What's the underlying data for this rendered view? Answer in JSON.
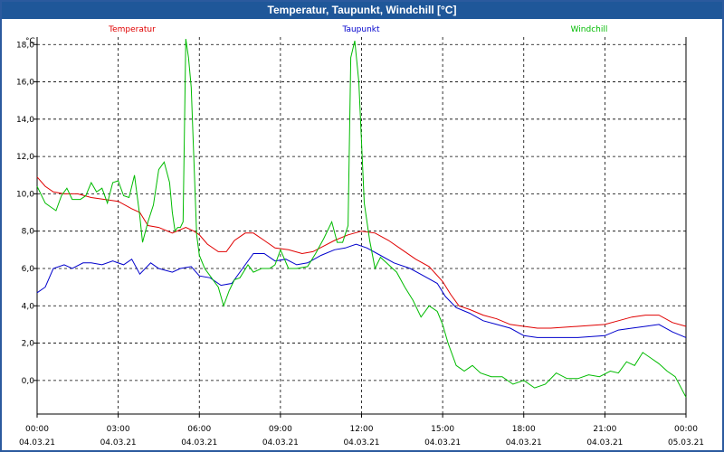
{
  "window": {
    "title": "Temperatur, Taupunkt, Windchill [°C]"
  },
  "chart_data": {
    "type": "line",
    "title": "Temperatur, Taupunkt, Windchill [°C]",
    "ylabel": "°C",
    "xlabel": "",
    "ylim": [
      -1.8,
      18.4
    ],
    "xlim": [
      0,
      24
    ],
    "grid": true,
    "legend_position": "top",
    "y_ticks": [
      "0,0",
      "2,0",
      "4,0",
      "6,0",
      "8,0",
      "10,0",
      "12,0",
      "14,0",
      "16,0",
      "18,0"
    ],
    "y_tick_values": [
      0,
      2,
      4,
      6,
      8,
      10,
      12,
      14,
      16,
      18
    ],
    "x_ticks": [
      {
        "time": "00:00",
        "date": "04.03.21",
        "x": 0
      },
      {
        "time": "03:00",
        "date": "04.03.21",
        "x": 3
      },
      {
        "time": "06:00",
        "date": "04.03.21",
        "x": 6
      },
      {
        "time": "09:00",
        "date": "04.03.21",
        "x": 9
      },
      {
        "time": "12:00",
        "date": "04.03.21",
        "x": 12
      },
      {
        "time": "15:00",
        "date": "04.03.21",
        "x": 15
      },
      {
        "time": "18:00",
        "date": "04.03.21",
        "x": 18
      },
      {
        "time": "21:00",
        "date": "04.03.21",
        "x": 21
      },
      {
        "time": "00:00",
        "date": "05.03.21",
        "x": 24
      }
    ],
    "series": [
      {
        "name": "Temperatur",
        "color": "#e00000",
        "points": [
          [
            0,
            10.9
          ],
          [
            0.3,
            10.4
          ],
          [
            0.6,
            10.1
          ],
          [
            1,
            10.0
          ],
          [
            1.5,
            10.0
          ],
          [
            2,
            9.8
          ],
          [
            2.5,
            9.7
          ],
          [
            3,
            9.6
          ],
          [
            3.5,
            9.2
          ],
          [
            3.8,
            9.0
          ],
          [
            4.1,
            8.3
          ],
          [
            4.5,
            8.2
          ],
          [
            5,
            7.9
          ],
          [
            5.5,
            8.2
          ],
          [
            5.8,
            8.0
          ],
          [
            6,
            7.8
          ],
          [
            6.3,
            7.3
          ],
          [
            6.7,
            6.9
          ],
          [
            7,
            6.9
          ],
          [
            7.3,
            7.5
          ],
          [
            7.7,
            7.9
          ],
          [
            8,
            7.9
          ],
          [
            8.4,
            7.5
          ],
          [
            8.8,
            7.1
          ],
          [
            9.3,
            7.0
          ],
          [
            9.8,
            6.8
          ],
          [
            10.2,
            6.9
          ],
          [
            10.6,
            7.2
          ],
          [
            11,
            7.5
          ],
          [
            11.5,
            7.8
          ],
          [
            12,
            8.0
          ],
          [
            12.5,
            7.9
          ],
          [
            13,
            7.5
          ],
          [
            13.5,
            7.0
          ],
          [
            14,
            6.5
          ],
          [
            14.5,
            6.1
          ],
          [
            15,
            5.3
          ],
          [
            15.3,
            4.6
          ],
          [
            15.6,
            4.0
          ],
          [
            16,
            3.8
          ],
          [
            16.5,
            3.5
          ],
          [
            17,
            3.3
          ],
          [
            17.5,
            3.0
          ],
          [
            18,
            2.9
          ],
          [
            18.5,
            2.8
          ],
          [
            19,
            2.8
          ],
          [
            20,
            2.9
          ],
          [
            21,
            3.0
          ],
          [
            21.5,
            3.2
          ],
          [
            22,
            3.4
          ],
          [
            22.5,
            3.5
          ],
          [
            23,
            3.5
          ],
          [
            23.5,
            3.1
          ],
          [
            24,
            2.9
          ]
        ]
      },
      {
        "name": "Taupunkt",
        "color": "#0000cc",
        "points": [
          [
            0,
            4.7
          ],
          [
            0.3,
            5.0
          ],
          [
            0.6,
            6.0
          ],
          [
            1,
            6.2
          ],
          [
            1.3,
            6.0
          ],
          [
            1.7,
            6.3
          ],
          [
            2,
            6.3
          ],
          [
            2.4,
            6.2
          ],
          [
            2.8,
            6.4
          ],
          [
            3.2,
            6.2
          ],
          [
            3.5,
            6.5
          ],
          [
            3.8,
            5.7
          ],
          [
            4.2,
            6.3
          ],
          [
            4.5,
            6.0
          ],
          [
            5,
            5.8
          ],
          [
            5.3,
            6.0
          ],
          [
            5.7,
            6.1
          ],
          [
            6,
            5.6
          ],
          [
            6.4,
            5.5
          ],
          [
            6.8,
            5.1
          ],
          [
            7.2,
            5.2
          ],
          [
            7.6,
            6.0
          ],
          [
            8,
            6.8
          ],
          [
            8.4,
            6.8
          ],
          [
            8.8,
            6.4
          ],
          [
            9.2,
            6.5
          ],
          [
            9.6,
            6.2
          ],
          [
            10,
            6.3
          ],
          [
            10.5,
            6.7
          ],
          [
            11,
            7.0
          ],
          [
            11.4,
            7.1
          ],
          [
            11.8,
            7.3
          ],
          [
            12.2,
            7.1
          ],
          [
            12.7,
            6.7
          ],
          [
            13.2,
            6.3
          ],
          [
            13.8,
            6.0
          ],
          [
            14.3,
            5.6
          ],
          [
            14.8,
            5.2
          ],
          [
            15.1,
            4.5
          ],
          [
            15.5,
            3.9
          ],
          [
            16,
            3.6
          ],
          [
            16.5,
            3.2
          ],
          [
            17,
            3.0
          ],
          [
            17.5,
            2.8
          ],
          [
            18,
            2.4
          ],
          [
            18.5,
            2.3
          ],
          [
            19,
            2.3
          ],
          [
            20,
            2.3
          ],
          [
            21,
            2.4
          ],
          [
            21.5,
            2.7
          ],
          [
            22,
            2.8
          ],
          [
            22.5,
            2.9
          ],
          [
            23,
            3.0
          ],
          [
            23.5,
            2.6
          ],
          [
            24,
            2.3
          ]
        ]
      },
      {
        "name": "Windchill",
        "color": "#00bb00",
        "points": [
          [
            0,
            10.4
          ],
          [
            0.3,
            9.5
          ],
          [
            0.5,
            9.3
          ],
          [
            0.7,
            9.1
          ],
          [
            0.9,
            9.9
          ],
          [
            1.1,
            10.3
          ],
          [
            1.3,
            9.7
          ],
          [
            1.6,
            9.7
          ],
          [
            1.8,
            9.9
          ],
          [
            2,
            10.6
          ],
          [
            2.2,
            10.1
          ],
          [
            2.4,
            10.3
          ],
          [
            2.6,
            9.5
          ],
          [
            2.8,
            10.6
          ],
          [
            3,
            10.7
          ],
          [
            3.2,
            9.9
          ],
          [
            3.4,
            9.8
          ],
          [
            3.6,
            11.0
          ],
          [
            3.8,
            8.8
          ],
          [
            3.9,
            7.4
          ],
          [
            4.1,
            8.5
          ],
          [
            4.3,
            9.4
          ],
          [
            4.5,
            11.3
          ],
          [
            4.7,
            11.7
          ],
          [
            4.9,
            10.6
          ],
          [
            5,
            9.0
          ],
          [
            5.1,
            8.0
          ],
          [
            5.2,
            8.2
          ],
          [
            5.3,
            8.2
          ],
          [
            5.4,
            8.5
          ],
          [
            5.5,
            18.3
          ],
          [
            5.6,
            17.3
          ],
          [
            5.7,
            15.7
          ],
          [
            5.9,
            7.8
          ],
          [
            6.0,
            6.7
          ],
          [
            6.2,
            6.0
          ],
          [
            6.4,
            5.6
          ],
          [
            6.7,
            5.0
          ],
          [
            6.9,
            4.0
          ],
          [
            7.1,
            4.8
          ],
          [
            7.3,
            5.4
          ],
          [
            7.5,
            5.5
          ],
          [
            7.8,
            6.2
          ],
          [
            8.0,
            5.8
          ],
          [
            8.3,
            6.0
          ],
          [
            8.6,
            6.0
          ],
          [
            8.8,
            6.2
          ],
          [
            9.0,
            7.0
          ],
          [
            9.3,
            6.0
          ],
          [
            9.6,
            6.0
          ],
          [
            10.0,
            6.1
          ],
          [
            10.3,
            6.8
          ],
          [
            10.6,
            7.6
          ],
          [
            10.9,
            8.5
          ],
          [
            11.1,
            7.4
          ],
          [
            11.3,
            7.4
          ],
          [
            11.5,
            8.3
          ],
          [
            11.6,
            17.3
          ],
          [
            11.75,
            18.2
          ],
          [
            11.9,
            16.0
          ],
          [
            12.1,
            9.5
          ],
          [
            12.3,
            7.5
          ],
          [
            12.5,
            6.0
          ],
          [
            12.7,
            6.6
          ],
          [
            13.0,
            6.2
          ],
          [
            13.3,
            5.8
          ],
          [
            13.6,
            5.0
          ],
          [
            13.9,
            4.3
          ],
          [
            14.2,
            3.4
          ],
          [
            14.5,
            4.0
          ],
          [
            14.8,
            3.7
          ],
          [
            15.0,
            3.0
          ],
          [
            15.2,
            2.0
          ],
          [
            15.5,
            0.8
          ],
          [
            15.8,
            0.5
          ],
          [
            16.1,
            0.8
          ],
          [
            16.4,
            0.4
          ],
          [
            16.8,
            0.2
          ],
          [
            17.2,
            0.2
          ],
          [
            17.6,
            -0.2
          ],
          [
            18.0,
            0.0
          ],
          [
            18.4,
            -0.4
          ],
          [
            18.8,
            -0.2
          ],
          [
            19.2,
            0.4
          ],
          [
            19.6,
            0.1
          ],
          [
            20.0,
            0.1
          ],
          [
            20.4,
            0.3
          ],
          [
            20.8,
            0.2
          ],
          [
            21.2,
            0.5
          ],
          [
            21.5,
            0.4
          ],
          [
            21.8,
            1.0
          ],
          [
            22.1,
            0.8
          ],
          [
            22.4,
            1.5
          ],
          [
            22.7,
            1.2
          ],
          [
            23.0,
            0.9
          ],
          [
            23.3,
            0.5
          ],
          [
            23.6,
            0.2
          ],
          [
            24.0,
            -0.9
          ]
        ]
      }
    ]
  }
}
